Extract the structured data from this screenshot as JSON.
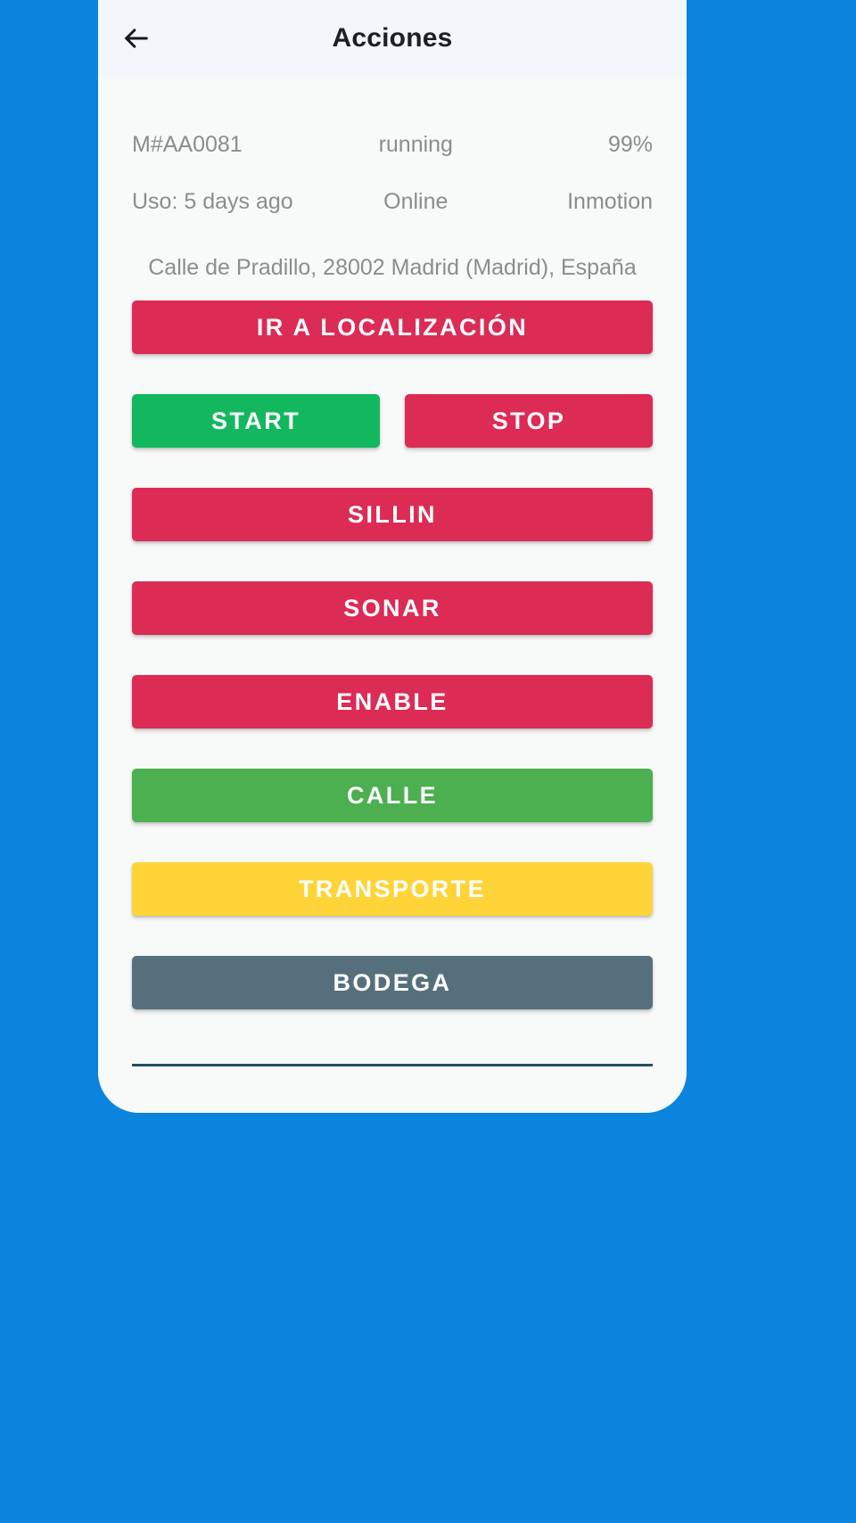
{
  "app_bar": {
    "back_icon": "arrow-left-icon",
    "title": "Acciones"
  },
  "info": {
    "row1": {
      "id": "M#AA0081",
      "state": "running",
      "battery": "99%"
    },
    "row2": {
      "usage": "Uso: 5 days ago",
      "connectivity": "Online",
      "motion": "Inmotion"
    },
    "address": "Calle de Pradillo, 28002 Madrid (Madrid), España"
  },
  "actions": {
    "go_to_location": "IR A LOCALIZACIÓN",
    "start": "START",
    "stop": "STOP",
    "sillin": "SILLIN",
    "sonar": "SONAR",
    "enable": "ENABLE",
    "calle": "CALLE",
    "transporte": "TRANSPORTE",
    "bodega": "BODEGA"
  },
  "colors": {
    "background": "#0b84de",
    "card": "#f8f9f9",
    "app_bar": "#f2f7fc",
    "crimson": "#dc2b55",
    "green": "#13b85e",
    "leaf_green": "#4caf50",
    "yellow": "#ffd438",
    "slate": "#55707c",
    "muted_text": "#8a8d8f",
    "rule": "#1f5163"
  }
}
